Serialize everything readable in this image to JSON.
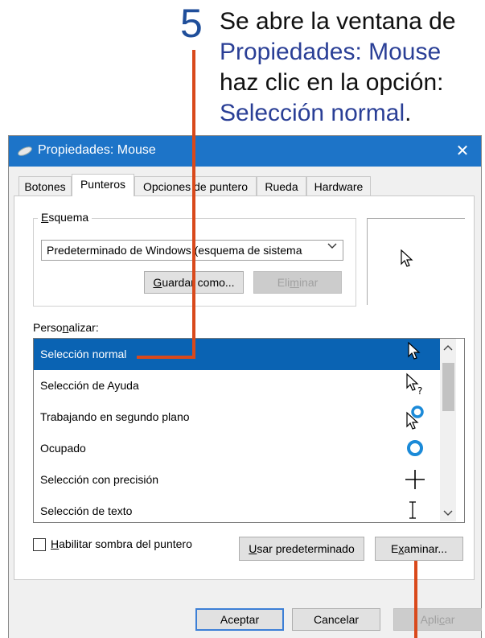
{
  "callout": {
    "step_number": "5",
    "line1": "Se abre la ventana de",
    "line2": "Propiedades: Mouse",
    "line3": "haz clic en la opción:",
    "line4_text": "Selección normal",
    "line4_period": "."
  },
  "window": {
    "title": "Propiedades: Mouse",
    "close_glyph": "✕",
    "accent_color": "#1d74c8"
  },
  "tabs": [
    {
      "label": "Botones",
      "active": false
    },
    {
      "label": "Punteros",
      "active": true
    },
    {
      "label": "Opciones de puntero",
      "active": false
    },
    {
      "label": "Rueda",
      "active": false
    },
    {
      "label": "Hardware",
      "active": false
    }
  ],
  "scheme": {
    "group_label_prefix": "E",
    "group_label_rest": "squema",
    "selected_value": "Predeterminado de Windows (esquema de sistema",
    "save_prefix": "G",
    "save_rest": "uardar como...",
    "delete_prefix": "Eli",
    "delete_mnemonic": "m",
    "delete_rest": "inar"
  },
  "customize": {
    "label_prefix": "Perso",
    "label_mnemonic": "n",
    "label_rest": "alizar:",
    "items": [
      {
        "label": "Selección normal",
        "icon": "arrow-pointer-icon",
        "selected": true
      },
      {
        "label": "Selección de Ayuda",
        "icon": "help-pointer-icon",
        "selected": false
      },
      {
        "label": "Trabajando en segundo plano",
        "icon": "working-in-background-icon",
        "selected": false
      },
      {
        "label": "Ocupado",
        "icon": "busy-icon",
        "selected": false
      },
      {
        "label": "Selección con precisión",
        "icon": "crosshair-icon",
        "selected": false
      },
      {
        "label": "Selección de texto",
        "icon": "text-beam-icon",
        "selected": false
      }
    ]
  },
  "shadow": {
    "label_prefix": "H",
    "label_rest": "abilitar sombra del puntero",
    "checked": false
  },
  "buttons": {
    "default_prefix": "U",
    "default_rest": "sar predeterminado",
    "browse_prefix": "E",
    "browse_mnemonic": "x",
    "browse_rest": "aminar...",
    "ok": "Aceptar",
    "cancel": "Cancelar",
    "apply_prefix": "Apli",
    "apply_mnemonic": "c",
    "apply_rest": "ar"
  }
}
